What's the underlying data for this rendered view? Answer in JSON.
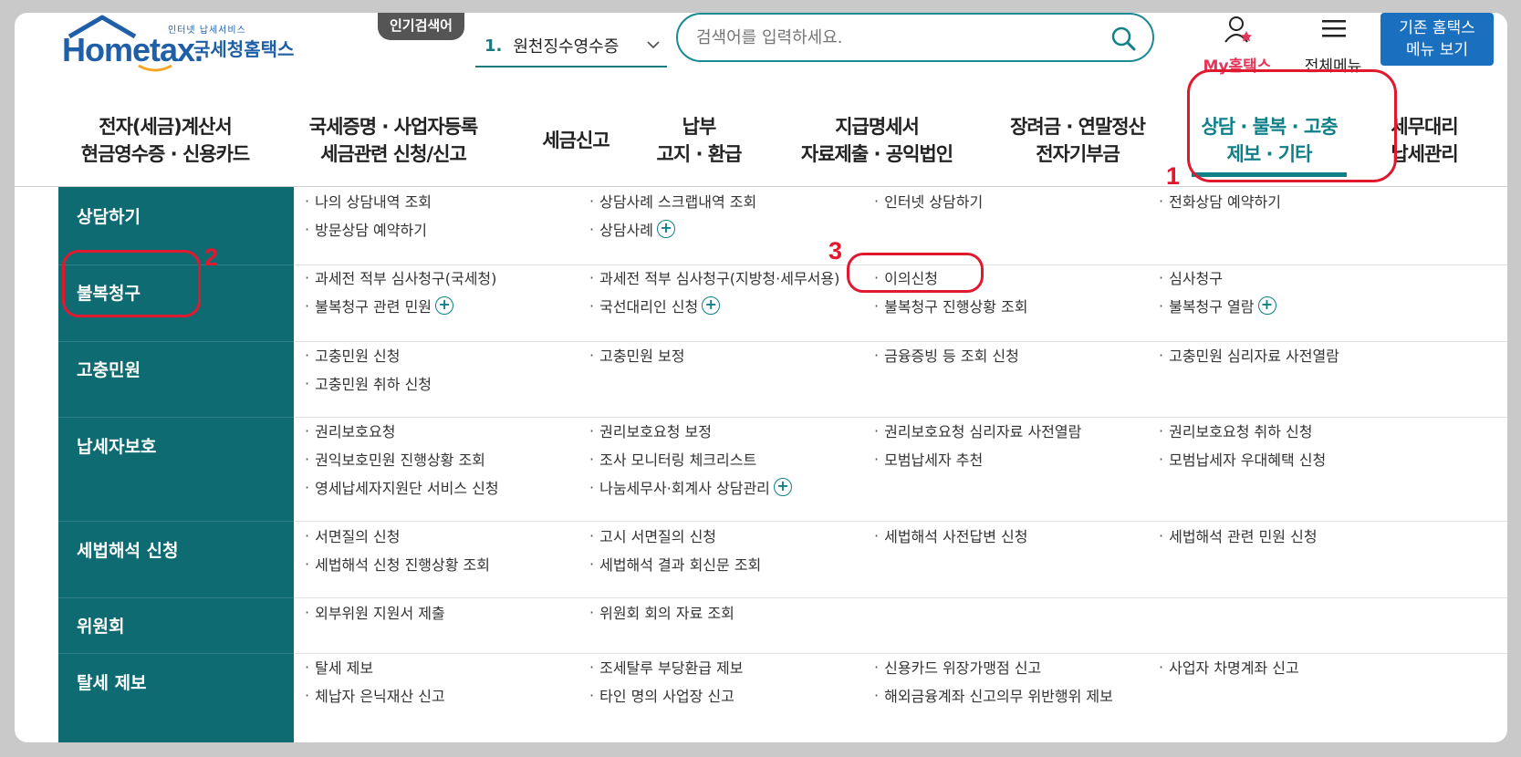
{
  "header": {
    "logo_tag": "인터넷 납세서비스",
    "logo_main": "Hometax.",
    "logo_ko": "국세청홈택스",
    "popular_label": "인기검색어",
    "popular_rank_num": "1.",
    "popular_rank_text": "원천징수영수증",
    "search_placeholder": "검색어를 입력하세요.",
    "my_hometax": "My홈택스",
    "all_menu": "전체메뉴",
    "legacy_line1": "기존 홈택스",
    "legacy_line2": "메뉴 보기"
  },
  "gnb": [
    {
      "l1": "전자(세금)계산서",
      "l2": "현금영수증 · 신용카드"
    },
    {
      "l1": "국세증명 · 사업자등록",
      "l2": "세금관련 신청/신고"
    },
    {
      "l1": "세금신고",
      "l2": ""
    },
    {
      "l1": "납부",
      "l2": "고지 · 환급"
    },
    {
      "l1": "지급명세서",
      "l2": "자료제출 · 공익법인"
    },
    {
      "l1": "장려금 · 연말정산",
      "l2": "전자기부금"
    },
    {
      "l1": "상담 · 불복 · 고충",
      "l2": "제보 · 기타"
    },
    {
      "l1": "세무대리",
      "l2": "납세관리"
    }
  ],
  "annotations": [
    "1",
    "2",
    "3"
  ],
  "categories": [
    {
      "name": "상담하기",
      "links": [
        [
          "나의 상담내역 조회",
          "상담사례 스크랩내역 조회",
          "인터넷 상담하기",
          "전화상담 예약하기"
        ],
        [
          "방문상담 예약하기",
          "상담사례",
          "",
          ""
        ]
      ]
    },
    {
      "name": "불복청구",
      "links": [
        [
          "과세전 적부 심사청구(국세청)",
          "과세전 적부 심사청구(지방청·세무서용)",
          "이의신청",
          "심사청구"
        ],
        [
          "불복청구 관련 민원",
          "국선대리인 신청",
          "불복청구 진행상황 조회",
          "불복청구 열람"
        ]
      ]
    },
    {
      "name": "고충민원",
      "links": [
        [
          "고충민원 신청",
          "고충민원 보정",
          "금융증빙 등 조회 신청",
          "고충민원 심리자료 사전열람"
        ],
        [
          "고충민원 취하 신청",
          "",
          "",
          ""
        ]
      ]
    },
    {
      "name": "납세자보호",
      "links": [
        [
          "권리보호요청",
          "권리보호요청 보정",
          "권리보호요청 심리자료 사전열람",
          "권리보호요청 취하 신청"
        ],
        [
          "권익보호민원 진행상황 조회",
          "조사 모니터링 체크리스트",
          "모범납세자 추천",
          "모범납세자 우대혜택 신청"
        ],
        [
          "영세납세자지원단 서비스 신청",
          "나눔세무사·회계사 상담관리",
          "",
          ""
        ]
      ]
    },
    {
      "name": "세법해석 신청",
      "links": [
        [
          "서면질의 신청",
          "고시 서면질의 신청",
          "세법해석 사전답변 신청",
          "세법해석 관련 민원 신청"
        ],
        [
          "세법해석 신청 진행상황 조회",
          "세법해석 결과 회신문 조회",
          "",
          ""
        ]
      ]
    },
    {
      "name": "위원회",
      "links": [
        [
          "외부위원 지원서 제출",
          "위원회 회의 자료 조회",
          "",
          ""
        ]
      ]
    },
    {
      "name": "탈세 제보",
      "links": [
        [
          "탈세 제보",
          "조세탈루 부당환급 제보",
          "신용카드 위장가맹점 신고",
          "사업자 차명계좌 신고"
        ],
        [
          "체납자 은닉재산 신고",
          "타인 명의 사업장 신고",
          "해외금융계좌 신고의무 위반행위 제보",
          ""
        ]
      ]
    }
  ],
  "colors": {
    "teal": "#0f6b72",
    "accent": "#0f7f88",
    "red_annotation": "#e0192e"
  }
}
